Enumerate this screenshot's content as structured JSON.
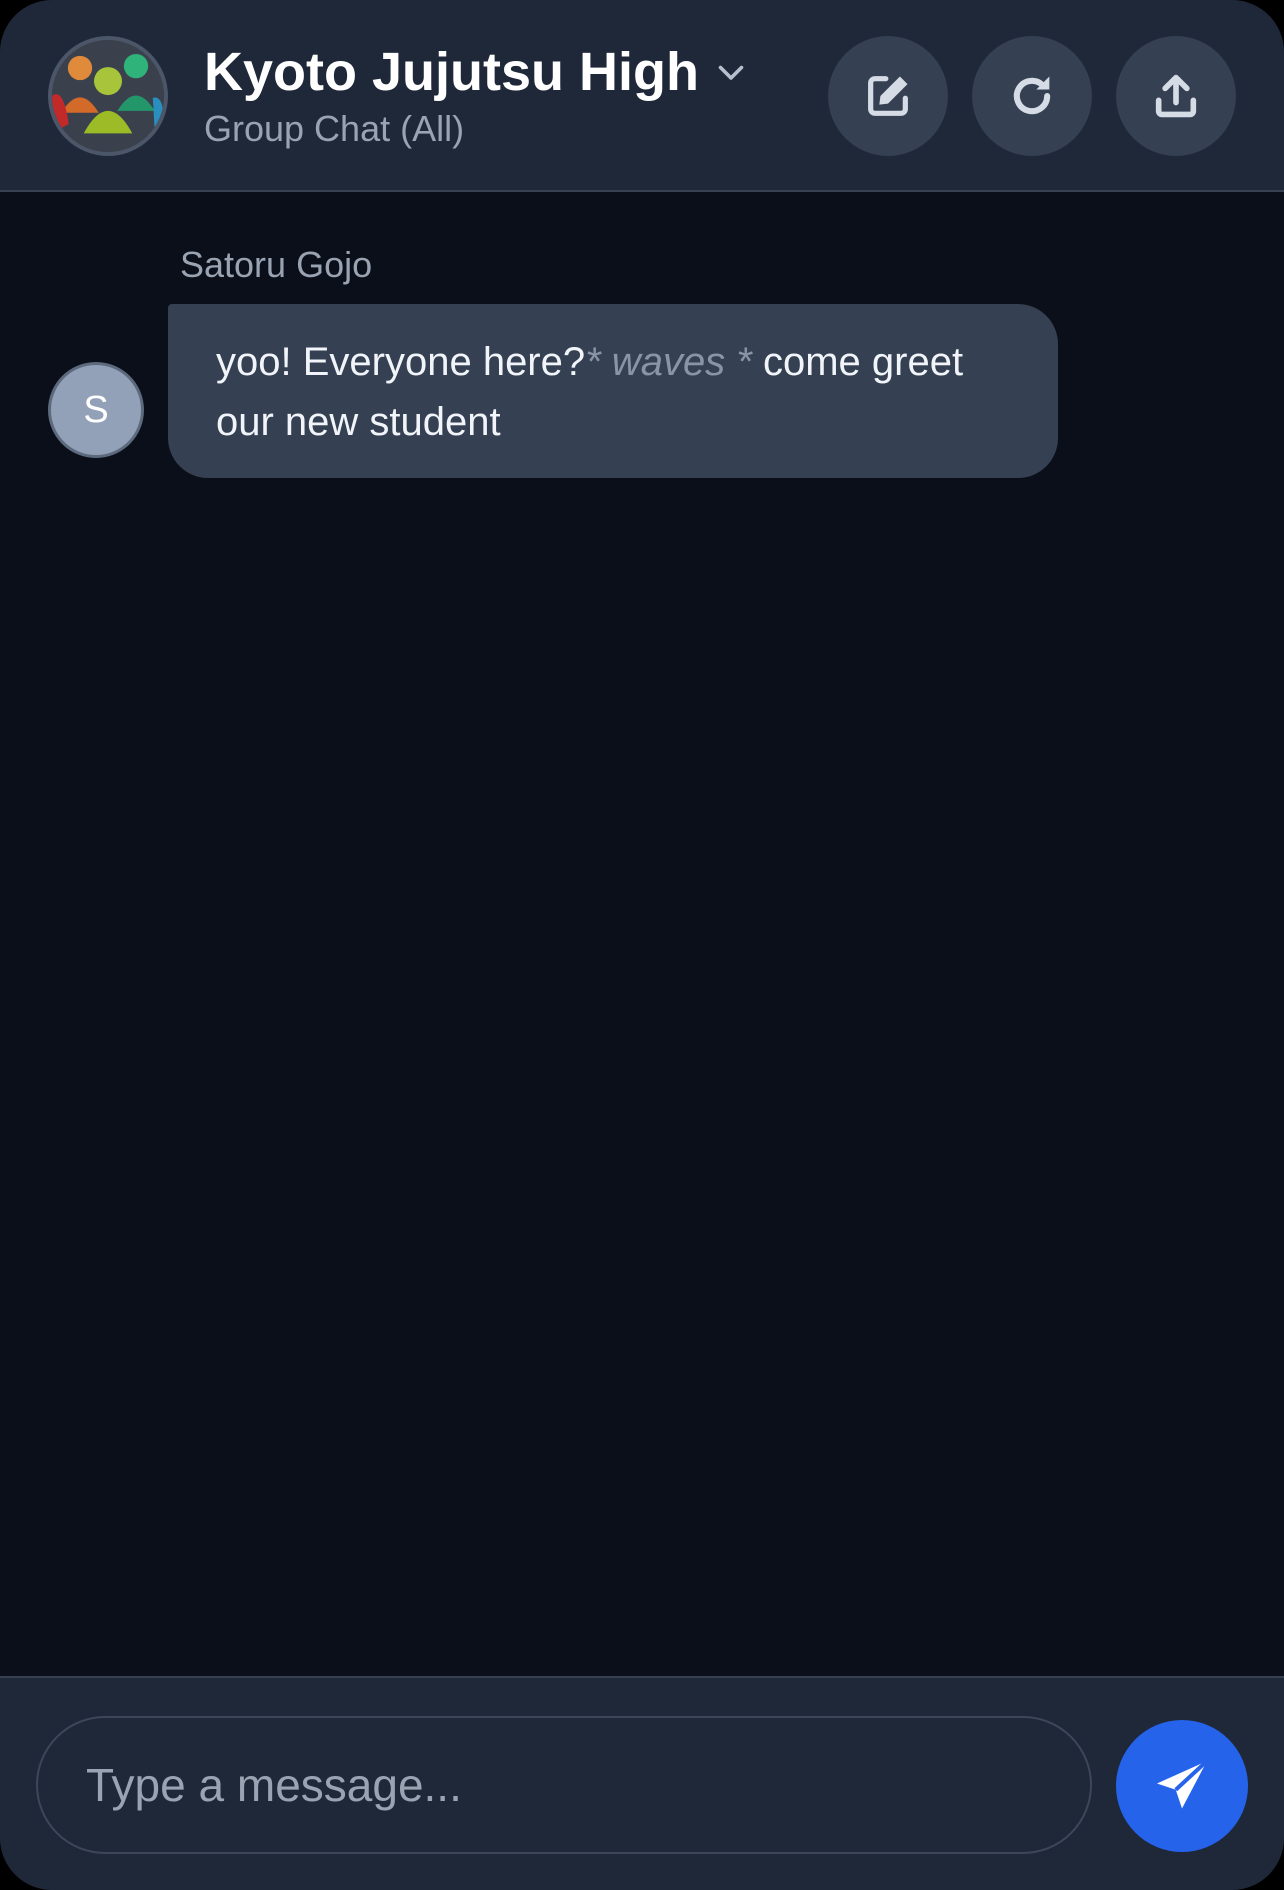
{
  "header": {
    "title": "Kyoto Jujutsu High",
    "subtitle": "Group Chat (All)",
    "avatar_icon": "group-people-icon",
    "dropdown_icon": "chevron-down-icon",
    "buttons": [
      {
        "name": "edit",
        "icon": "edit-icon"
      },
      {
        "name": "refresh",
        "icon": "refresh-icon"
      },
      {
        "name": "share",
        "icon": "upload-icon"
      }
    ]
  },
  "messages": [
    {
      "sender": "Satoru Gojo",
      "avatar_initial": "S",
      "parts": {
        "text1": "yoo! Everyone here?",
        "action": "* waves *",
        "text2": " come greet our new student"
      }
    }
  ],
  "composer": {
    "placeholder": "Type a message...",
    "value": "",
    "send_icon": "send-icon"
  },
  "colors": {
    "background": "#0b0f19",
    "header": "#1f2838",
    "bubble": "#354052",
    "accent": "#2563eb"
  }
}
